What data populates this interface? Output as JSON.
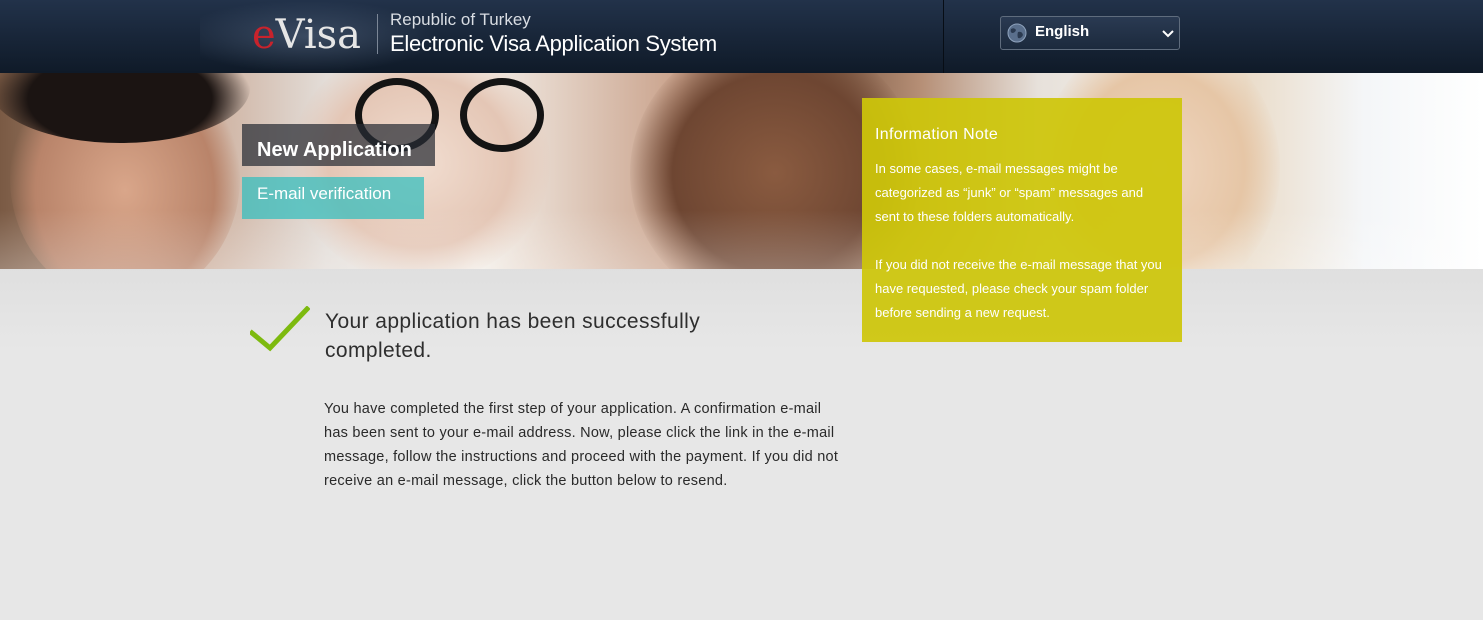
{
  "header": {
    "logo_e": "e",
    "logo_visa": "Visa",
    "line1": "Republic of Turkey",
    "line2": "Electronic Visa Application System",
    "language": {
      "selected": "English",
      "icon": "globe-icon",
      "chevron_icon": "chevron-down-icon"
    }
  },
  "banner": {
    "section_title": "New Application",
    "step_label": "E-mail verification"
  },
  "info_note": {
    "title": "Information Note",
    "paragraph1": "In some cases, e-mail messages might be categorized as “junk” or “spam” messages and sent to these folders automatically.",
    "paragraph2": "If you did not receive the e-mail message that you have requested, please check your spam folder before sending a new request."
  },
  "main": {
    "success_icon": "checkmark-icon",
    "success_message": "Your application has been successfully completed.",
    "body": "You have completed the first step of your application. A confirmation e-mail has been sent to your e-mail address. Now, please click the link in the e-mail message, follow the instructions and proceed with the payment. If you did not receive an e-mail message, click the button below to resend."
  },
  "colors": {
    "header_bg": "#1a2638",
    "logo_red": "#c8232c",
    "info_note_bg": "#cdc60a",
    "step_teal": "#32bebe",
    "check_green": "#7dba0f"
  }
}
